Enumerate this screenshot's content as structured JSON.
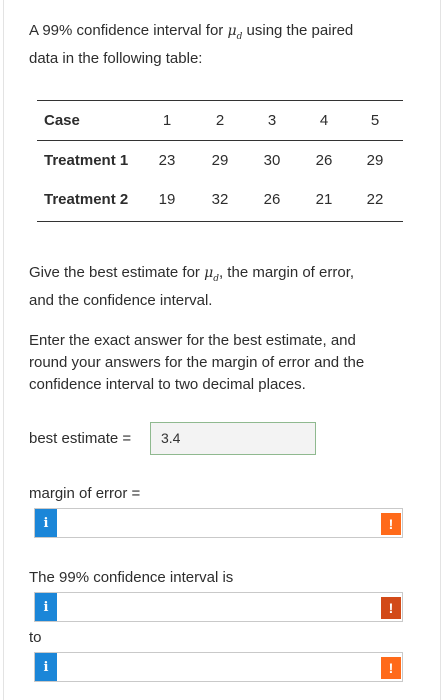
{
  "question": {
    "intro_pre": "A 99% confidence interval for",
    "mu": "μ",
    "sub": "d",
    "intro_post": "using the paired",
    "intro_line2": "data in the following table:"
  },
  "table": {
    "case_label": "Case",
    "cases": [
      "1",
      "2",
      "3",
      "4",
      "5"
    ],
    "rows": [
      {
        "label": "Treatment 1",
        "values": [
          "23",
          "29",
          "30",
          "26",
          "29"
        ]
      },
      {
        "label": "Treatment 2",
        "values": [
          "19",
          "32",
          "26",
          "21",
          "22"
        ]
      }
    ]
  },
  "prompt1": {
    "pre": "Give the best estimate for",
    "post": ", the margin of error,",
    "line2": "and the confidence interval."
  },
  "prompt2": {
    "line1": "Enter the exact answer for the best estimate, and",
    "line2": "round your answers for the margin of error and the",
    "line3": "confidence interval to two decimal places."
  },
  "best_estimate": {
    "label": "best estimate =",
    "value": "3.4"
  },
  "margin_of_error": {
    "label": "margin of error =",
    "value": ""
  },
  "ci": {
    "label": "The 99% confidence interval is",
    "to_label": "to",
    "lower": "",
    "upper": ""
  },
  "icons": {
    "info": "i",
    "warning": "!"
  },
  "colors": {
    "info": "#1b86d8",
    "warning": "#ff6a1a",
    "warning_dark": "#d24a18",
    "estimate_border": "#8fb98f"
  }
}
